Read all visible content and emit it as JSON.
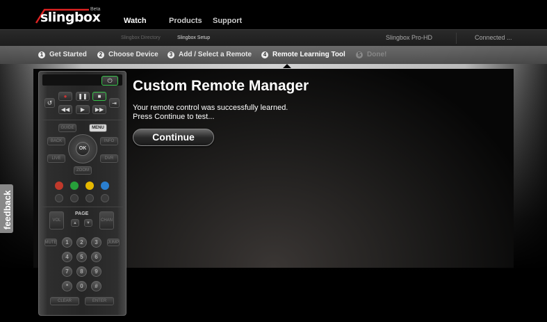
{
  "header": {
    "logo_text": "slingbox",
    "logo_badge": "Beta",
    "nav": [
      {
        "label": "Watch",
        "active": true
      },
      {
        "label": "Products",
        "active": false
      },
      {
        "label": "Support",
        "active": false
      }
    ]
  },
  "subnav": {
    "links": [
      {
        "label": "Slingbox Directory",
        "active": false
      },
      {
        "label": "Slingbox Setup",
        "active": true
      }
    ],
    "device_name": "Slingbox Pro-HD",
    "connection_status": "Connected ..."
  },
  "steps": [
    {
      "num": "1",
      "label": "Get Started",
      "state": "done"
    },
    {
      "num": "2",
      "label": "Choose Device",
      "state": "done"
    },
    {
      "num": "3",
      "label": "Add / Select a Remote",
      "state": "done"
    },
    {
      "num": "4",
      "label": "Remote Learning Tool",
      "state": "active"
    },
    {
      "num": "5",
      "label": "Done!",
      "state": "disabled"
    }
  ],
  "main": {
    "title": "Custom Remote Manager",
    "message_line1": "Your remote control was successfully learned.",
    "message_line2": "Press Continue to test...",
    "continue_label": "Continue"
  },
  "feedback_label": "feedback",
  "remote": {
    "power_icon": "power-icon",
    "transport": {
      "record": "record-icon",
      "pause": "pause-icon",
      "stop": "stop-icon",
      "rewind": "rewind-icon",
      "play": "play-icon",
      "fast_forward": "fast-forward-icon",
      "replay": "replay-icon",
      "skip": "skip-icon"
    },
    "guide": "GUIDE",
    "menu": "MENU",
    "back": "BACK",
    "info": "INFO",
    "live": "LIVE",
    "dvr": "DVR",
    "ok": "OK",
    "zoom": "ZOOM",
    "colors": [
      "#c0392b",
      "#27a03a",
      "#e6b800",
      "#2a7fd0"
    ],
    "vol": "VOL",
    "page": "PAGE",
    "chan": "CHAN",
    "mute": "MUTE",
    "jump": "JUMP",
    "numbers": [
      "1",
      "2",
      "3",
      "4",
      "5",
      "6",
      "7",
      "8",
      "9",
      "*",
      "0",
      "#"
    ],
    "clear": "CLEAR",
    "enter": "ENTER"
  }
}
